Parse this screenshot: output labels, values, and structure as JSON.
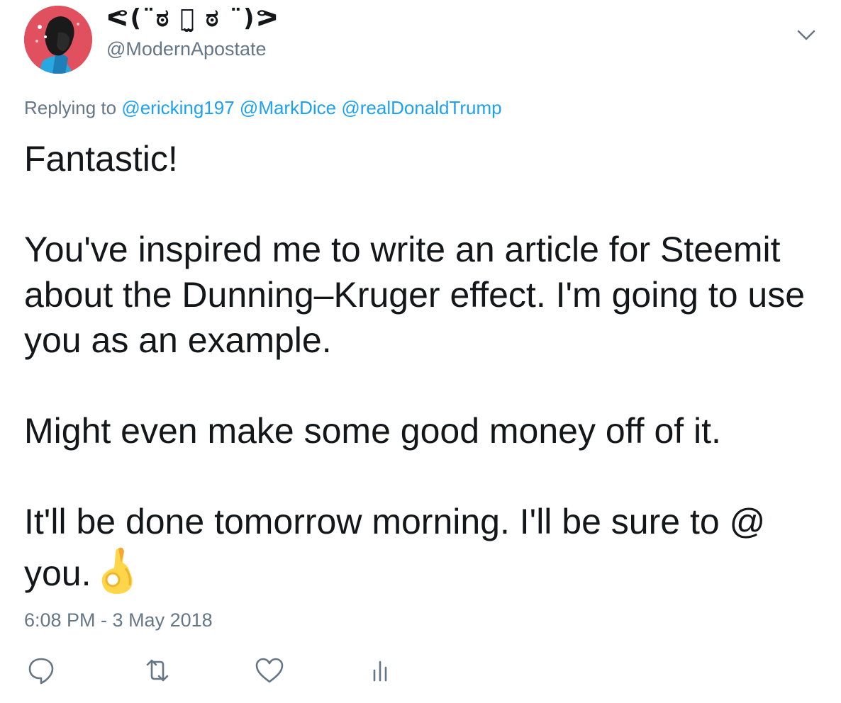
{
  "author": {
    "display_name": "ᕙ(⇀‸↼‶)ᕗ ఠ ͟ಠ ఠ",
    "display_name_render": "ᕙ(¨ಠ ఠ̫ ಠ ¨)ᕗ",
    "handle": "@ModernApostate",
    "avatar_icon": "avatar-icon"
  },
  "reply": {
    "prefix": "Replying to",
    "mentions": [
      "@ericking197",
      "@MarkDice",
      "@realDonaldTrump"
    ]
  },
  "tweet": {
    "paragraphs": [
      "Fantastic!",
      "You've inspired me to write an article for Steemit about the Dunning–Kruger effect. I'm going to use you as an example.",
      "Might even make some good money off of it.",
      "It'll be done tomorrow morning. I'll be sure to @ you."
    ],
    "trailing_emoji": "ok-hand-icon"
  },
  "timestamp": "6:08 PM - 3 May 2018",
  "actions": [
    {
      "icon": "reply-icon"
    },
    {
      "icon": "retweet-icon"
    },
    {
      "icon": "like-icon"
    },
    {
      "icon": "analytics-icon"
    }
  ],
  "colors": {
    "text": "#14171a",
    "secondary": "#657786",
    "link": "#1da1f2",
    "avatar_bg": "#e0505f"
  }
}
